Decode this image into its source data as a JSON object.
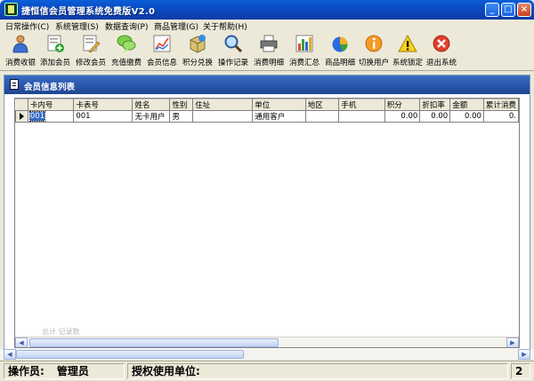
{
  "window": {
    "title": "捷恒信会员管理系统免费版V2.0",
    "min_label": "_",
    "max_label": "□",
    "close_label": "×"
  },
  "menu": [
    {
      "label": "日常操作(C)"
    },
    {
      "label": "系统管理(S)"
    },
    {
      "label": "数据查询(P)"
    },
    {
      "label": "商品管理(G)"
    },
    {
      "label": "关于帮助(H)"
    }
  ],
  "toolbar": [
    {
      "label": "消费收银",
      "icon": "person-icon"
    },
    {
      "label": "添加会员",
      "icon": "add-member-icon"
    },
    {
      "label": "修改会员",
      "icon": "edit-member-icon"
    },
    {
      "label": "充值缴费",
      "icon": "chat-recharge-icon"
    },
    {
      "label": "会员信息",
      "icon": "chart-info-icon"
    },
    {
      "label": "积分兑换",
      "icon": "box-exchange-icon"
    },
    {
      "label": "操作记录",
      "icon": "magnifier-icon"
    },
    {
      "label": "消费明细",
      "icon": "printer-icon"
    },
    {
      "label": "消费汇总",
      "icon": "bar-chart-icon"
    },
    {
      "label": "商品明细",
      "icon": "pie-chart-icon"
    },
    {
      "label": "切换用户",
      "icon": "info-icon"
    },
    {
      "label": "系统锁定",
      "icon": "warning-icon"
    },
    {
      "label": "退出系统",
      "icon": "close-circle-icon"
    }
  ],
  "panel": {
    "title": "会员信息列表"
  },
  "table": {
    "columns": [
      "卡内号",
      "卡表号",
      "姓名",
      "性别",
      "住址",
      "单位",
      "地区",
      "手机",
      "积分",
      "折扣率",
      "金额",
      "累计消费"
    ],
    "rows": [
      [
        "001",
        "001",
        "无卡用户",
        "男",
        "",
        "通用客户",
        "",
        "",
        "0.00",
        "0.00",
        "0.00",
        "0."
      ]
    ],
    "ghost_text": "总计 记录数"
  },
  "status": {
    "operator_label": "操作员:",
    "operator_value": "管理员",
    "license_label": "授权使用单位:",
    "license_value": "",
    "tail": "2"
  },
  "colors": {
    "title_bar": "#0b4bc4",
    "panel_header": "#2853a8",
    "selection": "#316ac5"
  }
}
